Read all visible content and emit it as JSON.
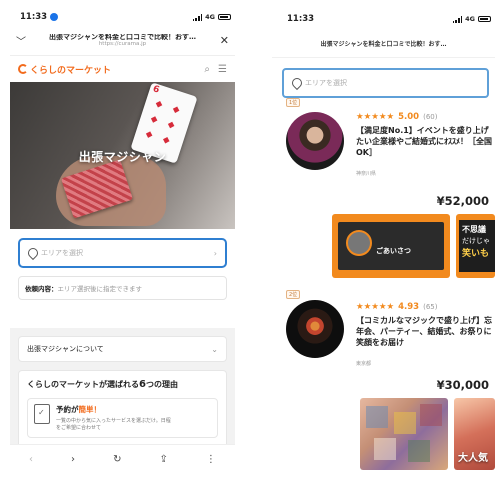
{
  "left": {
    "status": {
      "time": "11:33",
      "network": "4G"
    },
    "browser": {
      "title": "出張マジシャンを料金と口コミで比較！おす…",
      "url": "https://curama.jp"
    },
    "site": {
      "logo_text": "くらしのマーケット"
    },
    "hero": {
      "caption": "出張マジシャン",
      "card_number": "6"
    },
    "area_select": {
      "placeholder": "エリアを選択"
    },
    "request": {
      "label": "依頼内容：",
      "value": "エリア選択後に指定できます"
    },
    "about": {
      "label": "出張マジシャンについて"
    },
    "reasons": {
      "title_prefix": "くらしのマーケットが選ばれる",
      "title_number": "6",
      "title_suffix": "つの理由",
      "card_title_prefix": "予約が",
      "card_title_highlight": "簡単！",
      "card_desc_line1": "一覧の中から気に入ったサービスを選ぶだけ。日程",
      "card_desc_line2": "をご希望に合わせて"
    },
    "nav_icons": [
      "back-arrow",
      "forward-arrow",
      "reload",
      "share",
      "more"
    ]
  },
  "right": {
    "status": {
      "time": "11:33",
      "network": "4G"
    },
    "page_title": "出張マジシャンを料金と口コミで比較！おす…",
    "search": {
      "placeholder": "エリアを選択"
    },
    "listings": [
      {
        "rank": "1位",
        "stars": "★★★★★",
        "score": "5.00",
        "count": "(60)",
        "title": "【満足度No.1】イベントを盛り上げたい企業様やご結婚式にｵｽｽﾒ！［全国OK］",
        "location": "神奈川県",
        "price": "¥52,000",
        "thumb_a_text": "ごあいさつ",
        "thumb_b_line1": "不思議",
        "thumb_b_line2": "だけじゃ",
        "thumb_b_line3": "笑いも"
      },
      {
        "rank": "2位",
        "stars": "★★★★★",
        "score": "4.93",
        "count": "(65)",
        "title": "【コミカルなマジックで盛り上げ】忘年会、パーティー、結婚式、お祭りに笑顔をお届け",
        "location": "東京都",
        "price": "¥30,000",
        "thumb_d_text": "大人気"
      }
    ]
  }
}
